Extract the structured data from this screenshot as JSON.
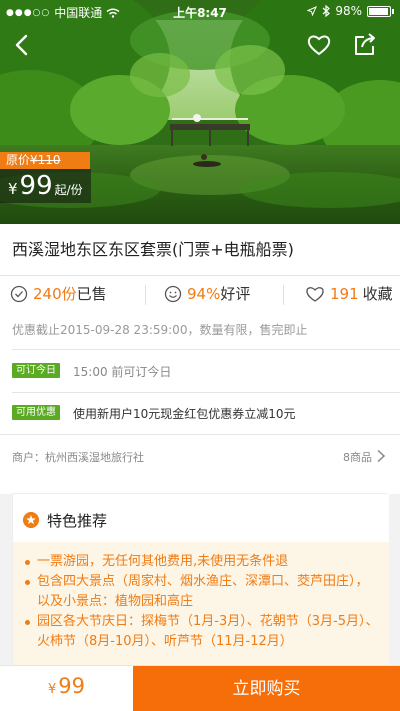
{
  "status_bar": {
    "signal": "●●●○○",
    "carrier": "中国联通",
    "time": "上午8:47",
    "battery": "98%"
  },
  "nav": {
    "back_icon": "chevron-left-icon",
    "favorite_icon": "heart-outline-icon",
    "share_icon": "share-icon"
  },
  "price": {
    "original_label": "原价",
    "original_currency": "¥",
    "original_value": "110",
    "currency": "¥",
    "value": "99",
    "unit": "起/份"
  },
  "product": {
    "title": "西溪湿地东区东区套票(门票+电瓶船票)"
  },
  "stats": {
    "sold_value": "240份",
    "sold_label": "已售",
    "rating_value": "94%",
    "rating_label": "好评",
    "fav_value": "191",
    "fav_label": "收藏"
  },
  "deadline": "优惠截止2015-09-28 23:59:00，数量有限，售完即止",
  "book_today": {
    "tag": "可订今日",
    "text": "15:00 前可订今日"
  },
  "discount": {
    "tag": "可用优惠",
    "text": "使用新用户10元现金红包优惠券立减10元"
  },
  "merchant": {
    "name": "商户：杭州西溪湿地旅行社",
    "count": "8商品"
  },
  "feature": {
    "title": "特色推荐",
    "items": [
      "一票游园，无任何其他费用,未使用无条件退",
      "包含四大景点（周家村、烟水渔庄、深潭口、茭芦田庄），以及小景点：植物园和高庄",
      "园区各大节庆日：探梅节（1月-3月）、花朝节（3月-5月）、火柿节（8月-10月）、听芦节（11月-12月）"
    ]
  },
  "bottom": {
    "currency": "¥",
    "price": "99",
    "buy_label": "立即购买"
  },
  "colors": {
    "accent": "#f07c14",
    "buy_button": "#f56e0a",
    "tag_green": "#5aaa23"
  }
}
